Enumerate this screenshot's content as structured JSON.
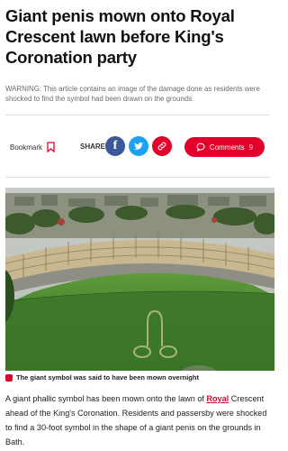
{
  "article": {
    "headline": "Giant penis mown onto Royal Crescent lawn before King's Coronation party",
    "warning": "WARNING: This article contains an image of the damage done as residents were shocked to find the symbol had been drawn on the grounds.",
    "caption": "The giant symbol was said to have been mown overnight",
    "body_before": "A giant phallic symbol has been mown onto the lawn of ",
    "body_link": "Royal",
    "body_after": " Crescent ahead of the King's Coronation. Residents and passersby were shocked to find a 30-foot symbol in the shape of a giant penis on the grounds in Bath."
  },
  "toolbar": {
    "bookmark_label": "Bookmark",
    "share_label": "SHARE",
    "comments_label": "Comments",
    "comments_count": "9"
  },
  "icons": {
    "bookmark": "bookmark-icon",
    "facebook": "facebook-icon",
    "twitter": "twitter-icon",
    "link": "link-icon",
    "comments": "comment-bubble-icon",
    "caption": "camera-icon"
  },
  "colors": {
    "accent": "#e3002b",
    "facebook": "#3b5998",
    "twitter": "#1da1f2",
    "link_text": "#c8102e"
  }
}
